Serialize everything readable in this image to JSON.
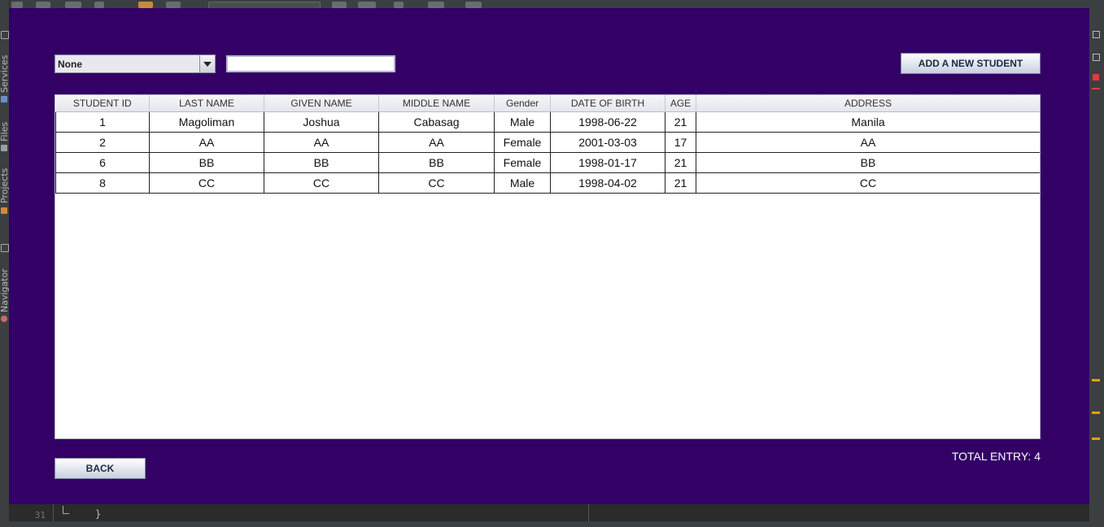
{
  "ide": {
    "side_tabs": [
      "Services",
      "Files",
      "Projects",
      "Navigator"
    ],
    "line_number": "31",
    "code_fragment": "}"
  },
  "filter": {
    "selected": "None",
    "search_value": ""
  },
  "buttons": {
    "add": "ADD A NEW STUDENT",
    "back": "BACK"
  },
  "table": {
    "columns": [
      "STUDENT ID",
      "LAST NAME",
      "GIVEN NAME",
      "MIDDLE NAME",
      "Gender",
      "DATE OF BIRTH",
      "AGE",
      "ADDRESS"
    ],
    "rows": [
      [
        "1",
        "Magoliman",
        "Joshua",
        "Cabasag",
        "Male",
        "1998-06-22",
        "21",
        "Manila"
      ],
      [
        "2",
        "AA",
        "AA",
        "AA",
        "Female",
        "2001-03-03",
        "17",
        "AA"
      ],
      [
        "6",
        "BB",
        "BB",
        "BB",
        "Female",
        "1998-01-17",
        "21",
        "BB"
      ],
      [
        "8",
        "CC",
        "CC",
        "CC",
        "Male",
        "1998-04-02",
        "21",
        "CC"
      ]
    ]
  },
  "footer": {
    "total_label": "TOTAL ENTRY: 4"
  },
  "colors": {
    "window_bg": "#330066",
    "ide_bg": "#3c3f41"
  }
}
